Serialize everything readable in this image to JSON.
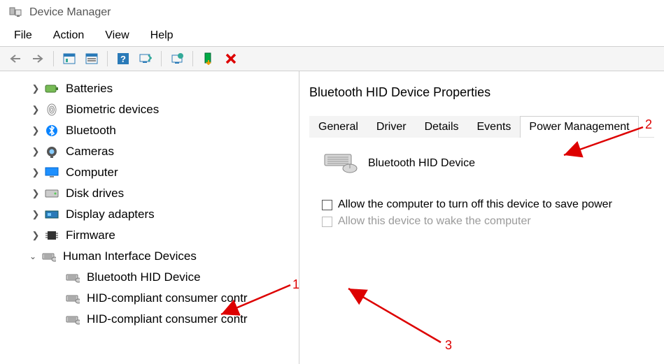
{
  "window": {
    "title": "Device Manager"
  },
  "menu": {
    "file": "File",
    "action": "Action",
    "view": "View",
    "help": "Help"
  },
  "tree": {
    "items": [
      {
        "label": "Batteries",
        "expandable": true
      },
      {
        "label": "Biometric devices",
        "expandable": true
      },
      {
        "label": "Bluetooth",
        "expandable": true
      },
      {
        "label": "Cameras",
        "expandable": true
      },
      {
        "label": "Computer",
        "expandable": true
      },
      {
        "label": "Disk drives",
        "expandable": true
      },
      {
        "label": "Display adapters",
        "expandable": true
      },
      {
        "label": "Firmware",
        "expandable": true
      },
      {
        "label": "Human Interface Devices",
        "expandable": true,
        "expanded": true,
        "children": [
          {
            "label": "Bluetooth HID Device"
          },
          {
            "label": "HID-compliant consumer contr"
          },
          {
            "label": "HID-compliant consumer contr"
          }
        ]
      }
    ]
  },
  "props": {
    "title": "Bluetooth HID Device Properties",
    "tabs": {
      "general": "General",
      "driver": "Driver",
      "details": "Details",
      "events": "Events",
      "power": "Power Management"
    },
    "active_tab": "power",
    "device_name": "Bluetooth HID Device",
    "chk1_label": "Allow the computer to turn off this device to save power",
    "chk2_label": "Allow this device to wake the computer"
  },
  "annotations": {
    "a1": "1",
    "a2": "2",
    "a3": "3"
  }
}
